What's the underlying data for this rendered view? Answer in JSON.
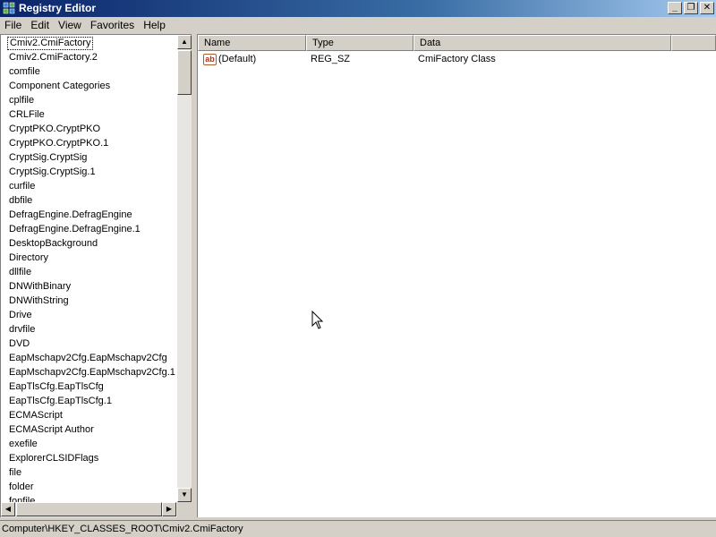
{
  "window": {
    "title": "Registry Editor"
  },
  "menu": [
    "File",
    "Edit",
    "View",
    "Favorites",
    "Help"
  ],
  "tree": {
    "items": [
      "Cmiv2.CmiFactory",
      "Cmiv2.CmiFactory.2",
      "comfile",
      "Component Categories",
      "cplfile",
      "CRLFile",
      "CryptPKO.CryptPKO",
      "CryptPKO.CryptPKO.1",
      "CryptSig.CryptSig",
      "CryptSig.CryptSig.1",
      "curfile",
      "dbfile",
      "DefragEngine.DefragEngine",
      "DefragEngine.DefragEngine.1",
      "DesktopBackground",
      "Directory",
      "dllfile",
      "DNWithBinary",
      "DNWithString",
      "Drive",
      "drvfile",
      "DVD",
      "EapMschapv2Cfg.EapMschapv2Cfg",
      "EapMschapv2Cfg.EapMschapv2Cfg.1",
      "EapTlsCfg.EapTlsCfg",
      "EapTlsCfg.EapTlsCfg.1",
      "ECMAScript",
      "ECMAScript Author",
      "exefile",
      "ExplorerCLSIDFlags",
      "file",
      "folder",
      "fonfile"
    ],
    "selected_index": 0
  },
  "values": {
    "columns": [
      "Name",
      "Type",
      "Data"
    ],
    "rows": [
      {
        "icon": "ab",
        "name": "(Default)",
        "type": "REG_SZ",
        "data": "CmiFactory Class"
      }
    ]
  },
  "status": {
    "path": "Computer\\HKEY_CLASSES_ROOT\\Cmiv2.CmiFactory"
  }
}
